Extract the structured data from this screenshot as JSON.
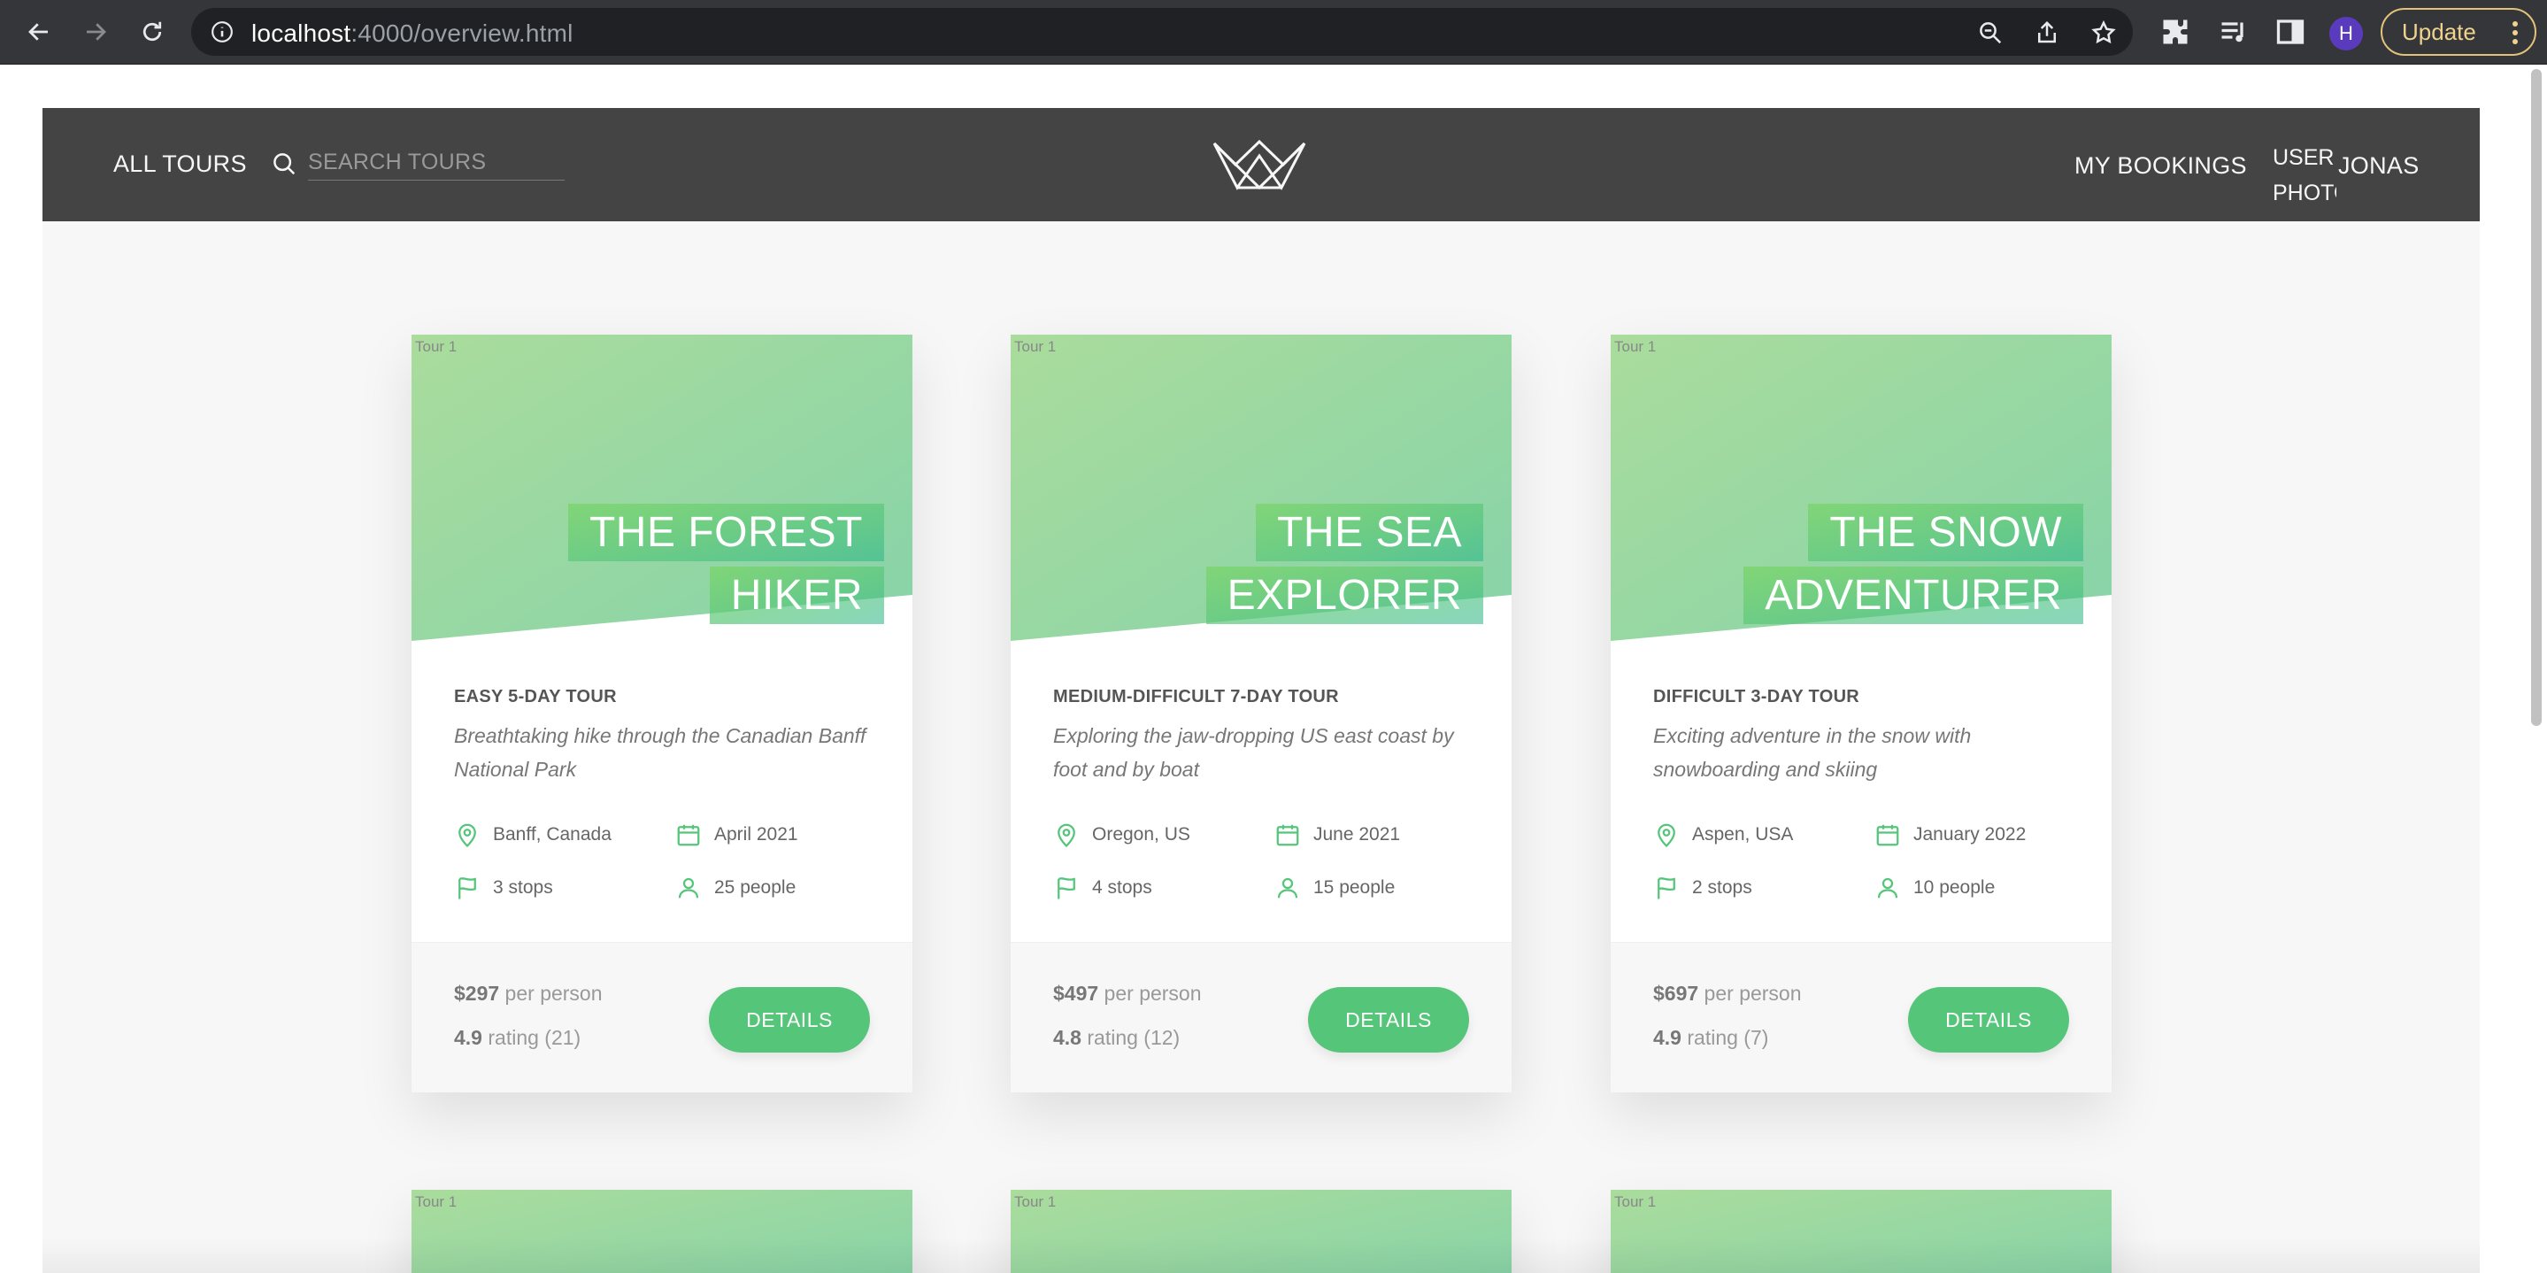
{
  "browser": {
    "url_host": "localhost",
    "url_path": ":4000/overview.html",
    "profile_initial": "H",
    "update_label": "Update"
  },
  "header": {
    "all_tours": "ALL TOURS",
    "search_placeholder": "SEARCH TOURS",
    "my_bookings": "MY BOOKINGS",
    "user_photo_alt": "USER PHOTO",
    "user_name": "JONAS"
  },
  "accent_color": "#55c57a",
  "tours": [
    {
      "image_alt": "Tour 1",
      "title_line1": "THE FOREST",
      "title_line2": "HIKER",
      "subheading": "EASY 5-DAY TOUR",
      "summary": "Breathtaking hike through the Canadian Banff National Park",
      "location": "Banff, Canada",
      "date": "April 2021",
      "stops": "3 stops",
      "people": "25 people",
      "price": "$297",
      "price_suffix": " per person",
      "rating": "4.9",
      "rating_suffix": " rating (21)",
      "button": "DETAILS"
    },
    {
      "image_alt": "Tour 1",
      "title_line1": "THE SEA",
      "title_line2": "EXPLORER",
      "subheading": "MEDIUM-DIFFICULT 7-DAY TOUR",
      "summary": "Exploring the jaw-dropping US east coast by foot and by boat",
      "location": "Oregon, US",
      "date": "June 2021",
      "stops": "4 stops",
      "people": "15 people",
      "price": "$497",
      "price_suffix": " per person",
      "rating": "4.8",
      "rating_suffix": " rating (12)",
      "button": "DETAILS"
    },
    {
      "image_alt": "Tour 1",
      "title_line1": "THE SNOW",
      "title_line2": "ADVENTURER",
      "subheading": "DIFFICULT 3-DAY TOUR",
      "summary": "Exciting adventure in the snow with snowboarding and skiing",
      "location": "Aspen, USA",
      "date": "January 2022",
      "stops": "2 stops",
      "people": "10 people",
      "price": "$697",
      "price_suffix": " per person",
      "rating": "4.9",
      "rating_suffix": " rating (7)",
      "button": "DETAILS"
    }
  ],
  "more_tours": [
    {
      "image_alt": "Tour 1"
    },
    {
      "image_alt": "Tour 1"
    },
    {
      "image_alt": "Tour 1"
    }
  ]
}
